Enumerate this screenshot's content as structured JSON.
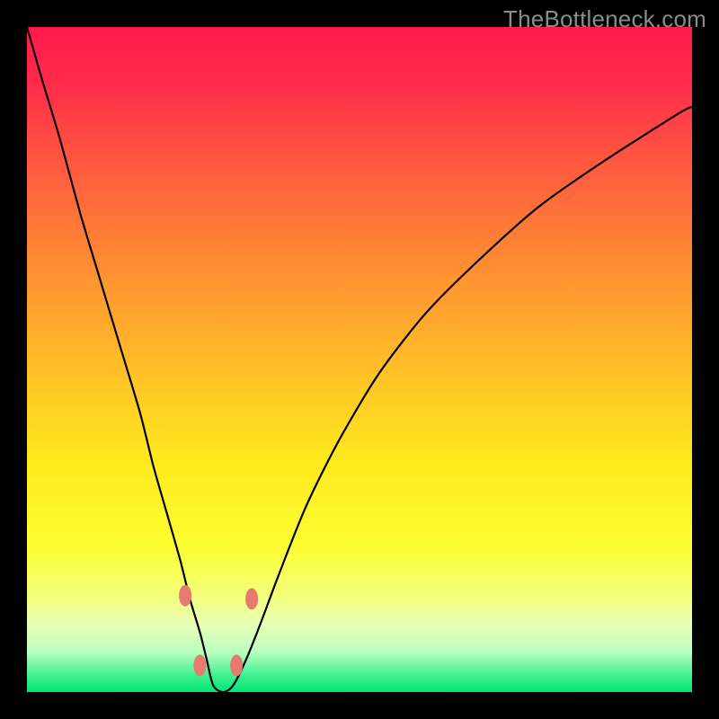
{
  "watermark": "TheBottleneck.com",
  "chart_data": {
    "type": "line",
    "title": "",
    "xlabel": "",
    "ylabel": "",
    "xlim": [
      0,
      100
    ],
    "ylim": [
      0,
      100
    ],
    "grid": false,
    "background_gradient": {
      "stops": [
        {
          "pos": 0.0,
          "color": "#ff1a4d"
        },
        {
          "pos": 0.08,
          "color": "#ff2a4a"
        },
        {
          "pos": 0.2,
          "color": "#ff5740"
        },
        {
          "pos": 0.35,
          "color": "#ff8a33"
        },
        {
          "pos": 0.5,
          "color": "#ffbb28"
        },
        {
          "pos": 0.65,
          "color": "#ffe81e"
        },
        {
          "pos": 0.78,
          "color": "#fbff30"
        },
        {
          "pos": 0.86,
          "color": "#f2ff80"
        },
        {
          "pos": 0.9,
          "color": "#e8ffb8"
        },
        {
          "pos": 0.94,
          "color": "#b8ffc0"
        },
        {
          "pos": 0.975,
          "color": "#40f090"
        },
        {
          "pos": 1.0,
          "color": "#00e676"
        }
      ]
    },
    "series": [
      {
        "name": "bottleneck-curve",
        "x": [
          0,
          2,
          5,
          8,
          11,
          14,
          17,
          19,
          21,
          23,
          24.5,
          26,
          27,
          28,
          29.5,
          31,
          33,
          35,
          38,
          42,
          47,
          53,
          60,
          68,
          77,
          87,
          98,
          100
        ],
        "y": [
          100,
          93,
          83,
          72,
          62,
          52,
          42,
          34,
          27,
          20,
          14,
          9,
          5,
          1,
          0,
          1,
          5,
          10,
          18,
          28,
          38,
          48,
          57,
          65,
          73,
          80,
          87,
          88
        ]
      }
    ],
    "markers": [
      {
        "name": "marker-left-upper",
        "x": 23.8,
        "y": 14.5
      },
      {
        "name": "marker-left-lower",
        "x": 26.0,
        "y": 4.0
      },
      {
        "name": "marker-right-lower",
        "x": 31.5,
        "y": 4.0
      },
      {
        "name": "marker-right-upper",
        "x": 33.8,
        "y": 14.0
      }
    ],
    "marker_style": {
      "fill": "#e77a6f",
      "rx": 7,
      "ry": 12
    }
  }
}
